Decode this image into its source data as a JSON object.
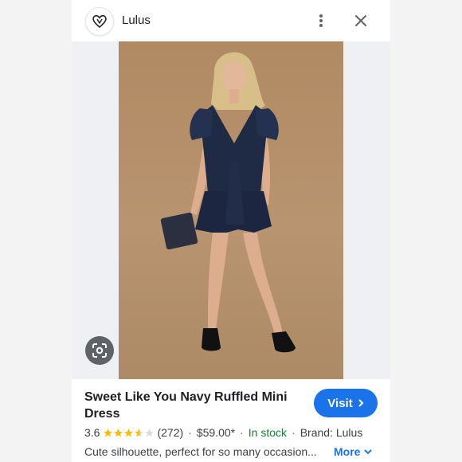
{
  "header": {
    "site_name": "Lulus",
    "logo_icon": "lulus-heart-logo",
    "menu_icon": "more-vertical-icon",
    "close_icon": "close-icon"
  },
  "image": {
    "lens_icon": "google-lens-icon"
  },
  "product": {
    "title": "Sweet Like You Navy Ruffled Mini Dress",
    "visit_label": "Visit",
    "rating": "3.6",
    "rating_value": 3.6,
    "review_count": "(272)",
    "price": "$59.00*",
    "stock": "In stock",
    "brand": "Brand: Lulus",
    "description": "Cute silhouette, perfect for so many occasion...",
    "more_label": "More"
  },
  "colors": {
    "accent": "#1a73e8",
    "stock_green": "#188038",
    "star": "#fbbc04",
    "dress": "#1f2a44"
  }
}
